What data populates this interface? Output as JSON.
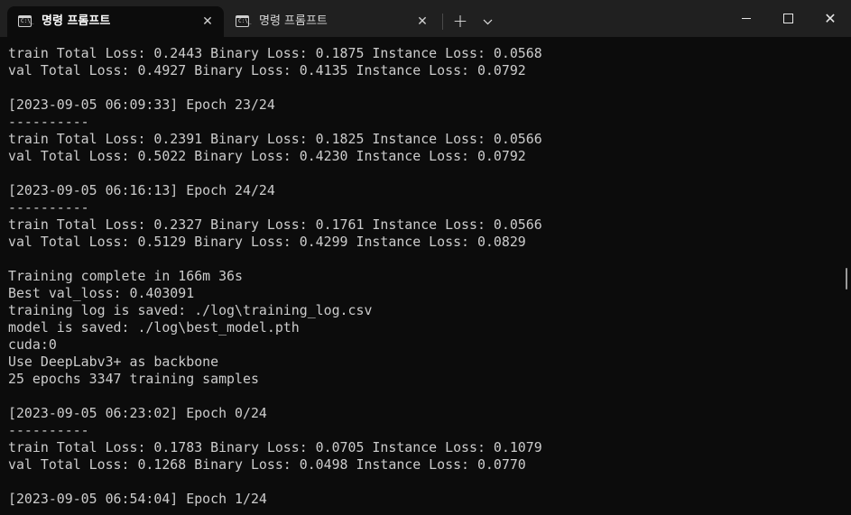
{
  "tabs": [
    {
      "icon": "cmd-icon",
      "icon_text": "C:\\_",
      "title": "명령 프롬프트",
      "close": "✕",
      "active": true
    },
    {
      "icon": "cmd-icon",
      "icon_text": "C:\\_",
      "title": "명령 프롬프트",
      "close": "✕",
      "active": false
    }
  ],
  "toolbar": {
    "new_tab": "+",
    "dropdown": "⌄"
  },
  "window_controls": {
    "close": "✕"
  },
  "console": {
    "lines": [
      "train Total Loss: 0.2443 Binary Loss: 0.1875 Instance Loss: 0.0568",
      "val Total Loss: 0.4927 Binary Loss: 0.4135 Instance Loss: 0.0792",
      "",
      "[2023-09-05 06:09:33] Epoch 23/24",
      "----------",
      "train Total Loss: 0.2391 Binary Loss: 0.1825 Instance Loss: 0.0566",
      "val Total Loss: 0.5022 Binary Loss: 0.4230 Instance Loss: 0.0792",
      "",
      "[2023-09-05 06:16:13] Epoch 24/24",
      "----------",
      "train Total Loss: 0.2327 Binary Loss: 0.1761 Instance Loss: 0.0566",
      "val Total Loss: 0.5129 Binary Loss: 0.4299 Instance Loss: 0.0829",
      "",
      "Training complete in 166m 36s",
      "Best val_loss: 0.403091",
      "training log is saved: ./log\\training_log.csv",
      "model is saved: ./log\\best_model.pth",
      "cuda:0",
      "Use DeepLabv3+ as backbone",
      "25 epochs 3347 training samples",
      "",
      "[2023-09-05 06:23:02] Epoch 0/24",
      "----------",
      "train Total Loss: 0.1783 Binary Loss: 0.0705 Instance Loss: 0.1079",
      "val Total Loss: 0.1268 Binary Loss: 0.0498 Instance Loss: 0.0770",
      "",
      "[2023-09-05 06:54:04] Epoch 1/24"
    ]
  },
  "colors": {
    "background": "#0c0c0c",
    "titlebar": "#202020",
    "text": "#cccccc"
  }
}
